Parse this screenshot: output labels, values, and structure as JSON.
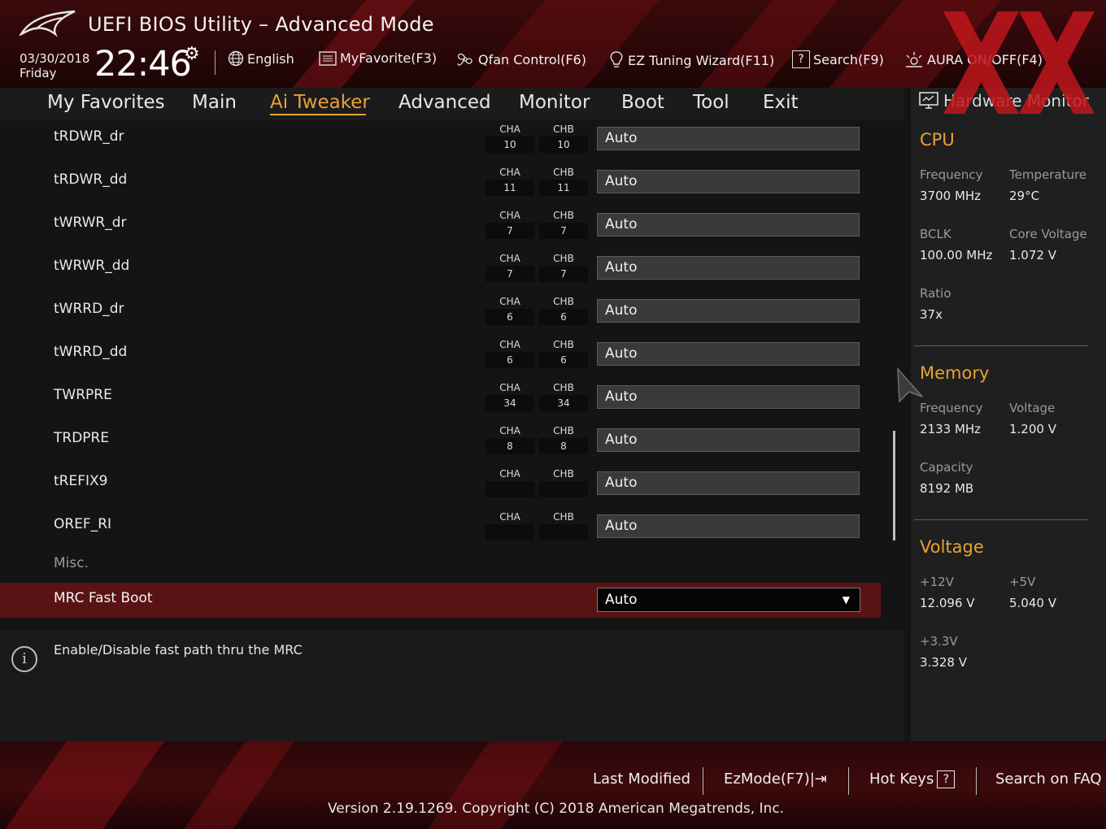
{
  "header": {
    "title": "UEFI BIOS Utility – Advanced Mode",
    "date": "03/30/2018",
    "weekday": "Friday",
    "time": "22:46",
    "toolbar": [
      {
        "name": "language",
        "label": "English",
        "icon": "globe-icon"
      },
      {
        "name": "myfavorite",
        "label": "MyFavorite(F3)",
        "icon": "list-icon"
      },
      {
        "name": "qfan",
        "label": "Qfan Control(F6)",
        "icon": "fan-icon"
      },
      {
        "name": "ez-tuning",
        "label": "EZ Tuning Wizard(F11)",
        "icon": "bulb-icon"
      },
      {
        "name": "search",
        "label": "Search(F9)",
        "icon": "help-box-icon"
      },
      {
        "name": "aura",
        "label": "AURA ON/OFF(F4)",
        "icon": "aura-icon"
      }
    ]
  },
  "nav": {
    "tabs": [
      "My Favorites",
      "Main",
      "Ai Tweaker",
      "Advanced",
      "Monitor",
      "Boot",
      "Tool",
      "Exit"
    ],
    "active": "Ai Tweaker"
  },
  "channel_labels": {
    "a": "CHA",
    "b": "CHB"
  },
  "rows": [
    {
      "label": "tRDWR_dr",
      "cha": "10",
      "chb": "10",
      "value": "Auto"
    },
    {
      "label": "tRDWR_dd",
      "cha": "11",
      "chb": "11",
      "value": "Auto"
    },
    {
      "label": "tWRWR_dr",
      "cha": "7",
      "chb": "7",
      "value": "Auto"
    },
    {
      "label": "tWRWR_dd",
      "cha": "7",
      "chb": "7",
      "value": "Auto"
    },
    {
      "label": "tWRRD_dr",
      "cha": "6",
      "chb": "6",
      "value": "Auto"
    },
    {
      "label": "tWRRD_dd",
      "cha": "6",
      "chb": "6",
      "value": "Auto"
    },
    {
      "label": "TWRPRE",
      "cha": "34",
      "chb": "34",
      "value": "Auto"
    },
    {
      "label": "TRDPRE",
      "cha": "8",
      "chb": "8",
      "value": "Auto"
    },
    {
      "label": "tREFIX9",
      "cha": "",
      "chb": "",
      "value": "Auto"
    },
    {
      "label": "OREF_RI",
      "cha": "",
      "chb": "",
      "value": "Auto"
    }
  ],
  "misc_heading": "Misc.",
  "selected_row": {
    "label": "MRC Fast Boot",
    "value": "Auto"
  },
  "help_text": "Enable/Disable fast path thru the MRC",
  "hw_monitor": {
    "title": "Hardware Monitor",
    "cpu": {
      "heading": "CPU",
      "frequency_label": "Frequency",
      "frequency": "3700 MHz",
      "temperature_label": "Temperature",
      "temperature": "29°C",
      "bclk_label": "BCLK",
      "bclk": "100.00 MHz",
      "core_voltage_label": "Core Voltage",
      "core_voltage": "1.072 V",
      "ratio_label": "Ratio",
      "ratio": "37x"
    },
    "memory": {
      "heading": "Memory",
      "frequency_label": "Frequency",
      "frequency": "2133 MHz",
      "voltage_label": "Voltage",
      "voltage": "1.200 V",
      "capacity_label": "Capacity",
      "capacity": "8192 MB"
    },
    "voltage": {
      "heading": "Voltage",
      "v12_label": "+12V",
      "v12": "12.096 V",
      "v5_label": "+5V",
      "v5": "5.040 V",
      "v33_label": "+3.3V",
      "v33": "3.328 V"
    }
  },
  "footer": {
    "last_modified": "Last Modified",
    "ezmode": "EzMode(F7)|",
    "hot_keys": "Hot Keys",
    "search_faq": "Search on FAQ",
    "version": "Version 2.19.1269. Copyright (C) 2018 American Megatrends, Inc."
  },
  "colors": {
    "accent": "#e7a236",
    "selected_row": "#5a1315",
    "watermark": "#c0161c"
  }
}
